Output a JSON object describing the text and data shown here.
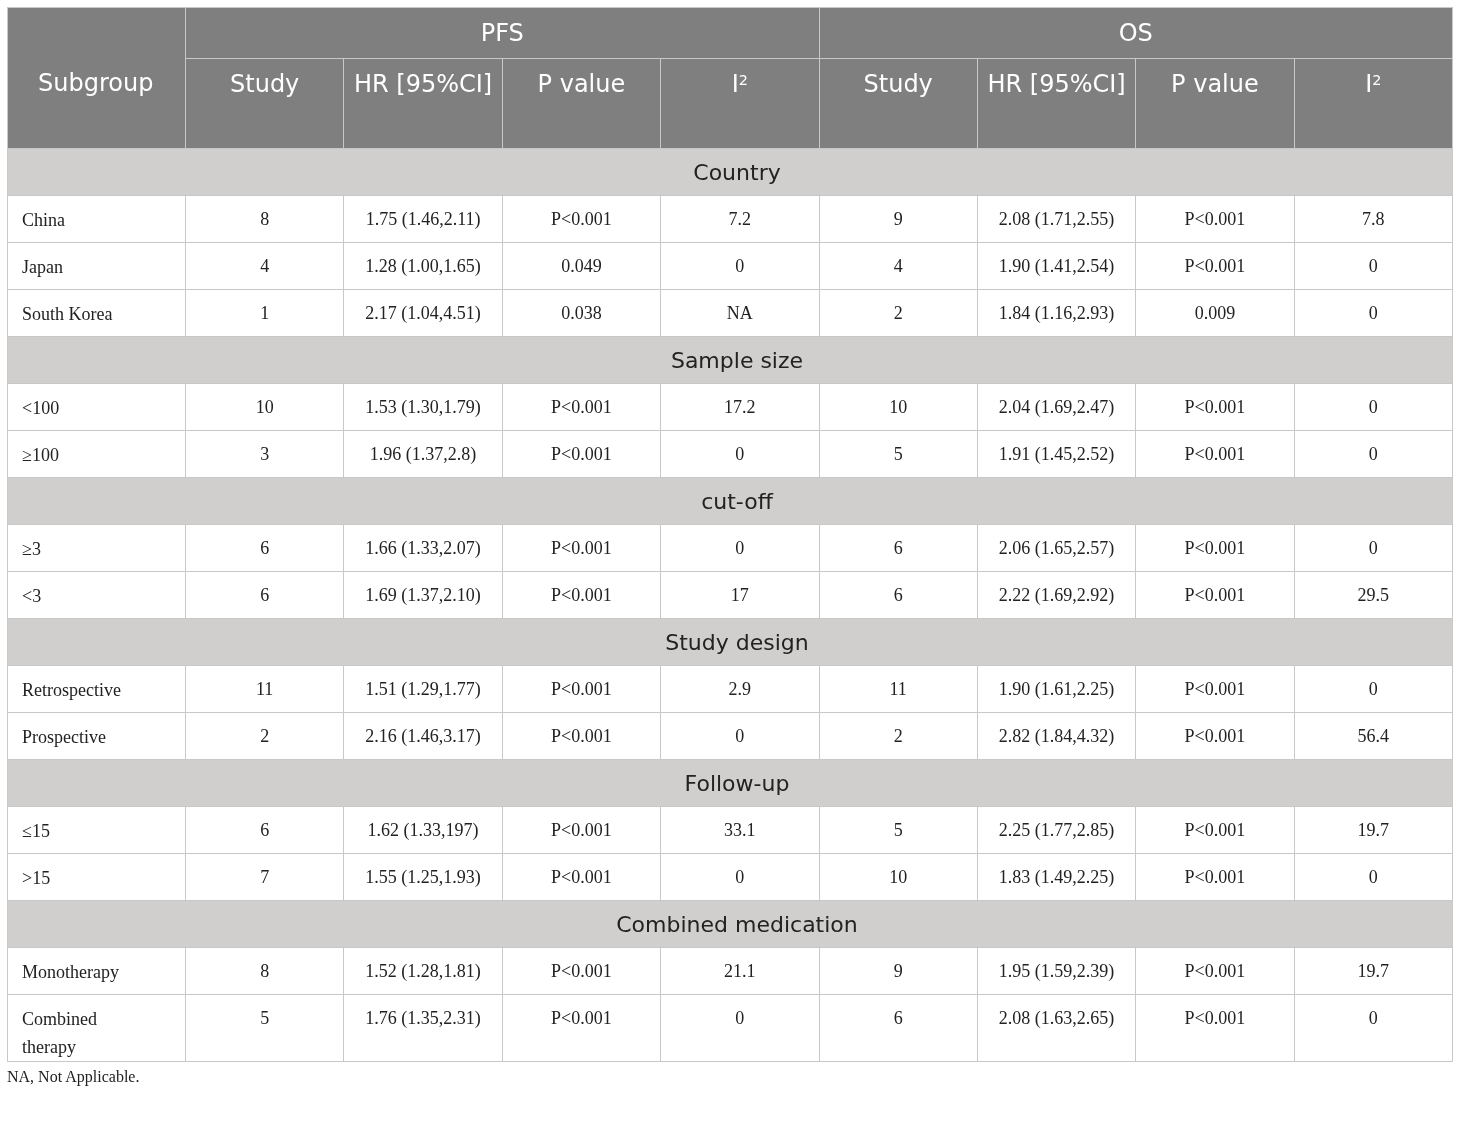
{
  "table": {
    "subgroup_header": "Subgroup",
    "groups": [
      {
        "label": "PFS",
        "columns": [
          "Study",
          "HR [95%CI]",
          "P value",
          "I$^{2}$"
        ]
      },
      {
        "label": "OS",
        "columns": [
          "Study",
          "HR [95%CI]",
          "P value",
          "I$^{2}$"
        ]
      }
    ],
    "sections": [
      {
        "title": "Country",
        "rows": [
          {
            "subgroup": "China",
            "cells": [
              "8",
              "1.75 (1.46,2.11)",
              "P<0.001",
              "7.2",
              "9",
              "2.08 (1.71,2.55)",
              "P<0.001",
              "7.8"
            ]
          },
          {
            "subgroup": "Japan",
            "cells": [
              "4",
              "1.28 (1.00,1.65)",
              "0.049",
              "0",
              "4",
              "1.90 (1.41,2.54)",
              "P<0.001",
              "0"
            ]
          },
          {
            "subgroup": "South Korea",
            "cells": [
              "1",
              "2.17 (1.04,4.51)",
              "0.038",
              "NA",
              "2",
              "1.84 (1.16,2.93)",
              "0.009",
              "0"
            ]
          }
        ]
      },
      {
        "title": "Sample size",
        "rows": [
          {
            "subgroup": "<100",
            "cells": [
              "10",
              "1.53 (1.30,1.79)",
              "P<0.001",
              "17.2",
              "10",
              "2.04 (1.69,2.47)",
              "P<0.001",
              "0"
            ]
          },
          {
            "subgroup": "≥100",
            "cells": [
              "3",
              "1.96 (1.37,2.8)",
              "P<0.001",
              "0",
              "5",
              "1.91 (1.45,2.52)",
              "P<0.001",
              "0"
            ]
          }
        ]
      },
      {
        "title": "cut-off",
        "rows": [
          {
            "subgroup": "≥3",
            "cells": [
              "6",
              "1.66 (1.33,2.07)",
              "P<0.001",
              "0",
              "6",
              "2.06 (1.65,2.57)",
              "P<0.001",
              "0"
            ]
          },
          {
            "subgroup": "<3",
            "cells": [
              "6",
              "1.69 (1.37,2.10)",
              "P<0.001",
              "17",
              "6",
              "2.22 (1.69,2.92)",
              "P<0.001",
              "29.5"
            ]
          }
        ]
      },
      {
        "title": "Study design",
        "rows": [
          {
            "subgroup": "Retrospective",
            "cells": [
              "11",
              "1.51 (1.29,1.77)",
              "P<0.001",
              "2.9",
              "11",
              "1.90 (1.61,2.25)",
              "P<0.001",
              "0"
            ]
          },
          {
            "subgroup": "Prospective",
            "cells": [
              "2",
              "2.16 (1.46,3.17)",
              "P<0.001",
              "0",
              "2",
              "2.82 (1.84,4.32)",
              "P<0.001",
              "56.4"
            ]
          }
        ]
      },
      {
        "title": "Follow-up",
        "rows": [
          {
            "subgroup": "≤15",
            "cells": [
              "6",
              "1.62 (1.33,197)",
              "P<0.001",
              "33.1",
              "5",
              "2.25 (1.77,2.85)",
              "P<0.001",
              "19.7"
            ]
          },
          {
            "subgroup": ">15",
            "cells": [
              "7",
              "1.55 (1.25,1.93)",
              "P<0.001",
              "0",
              "10",
              "1.83 (1.49,2.25)",
              "P<0.001",
              "0"
            ]
          }
        ]
      },
      {
        "title": "Combined medication",
        "rows": [
          {
            "subgroup": "Monotherapy",
            "cells": [
              "8",
              "1.52 (1.28,1.81)",
              "P<0.001",
              "21.1",
              "9",
              "1.95 (1.59,2.39)",
              "P<0.001",
              "19.7"
            ]
          },
          {
            "subgroup": "Combined therapy",
            "cells": [
              "5",
              "1.76 (1.35,2.31)",
              "P<0.001",
              "0",
              "6",
              "2.08 (1.63,2.65)",
              "P<0.001",
              "0"
            ]
          }
        ]
      }
    ]
  },
  "footnote": "NA, Not Applicable."
}
